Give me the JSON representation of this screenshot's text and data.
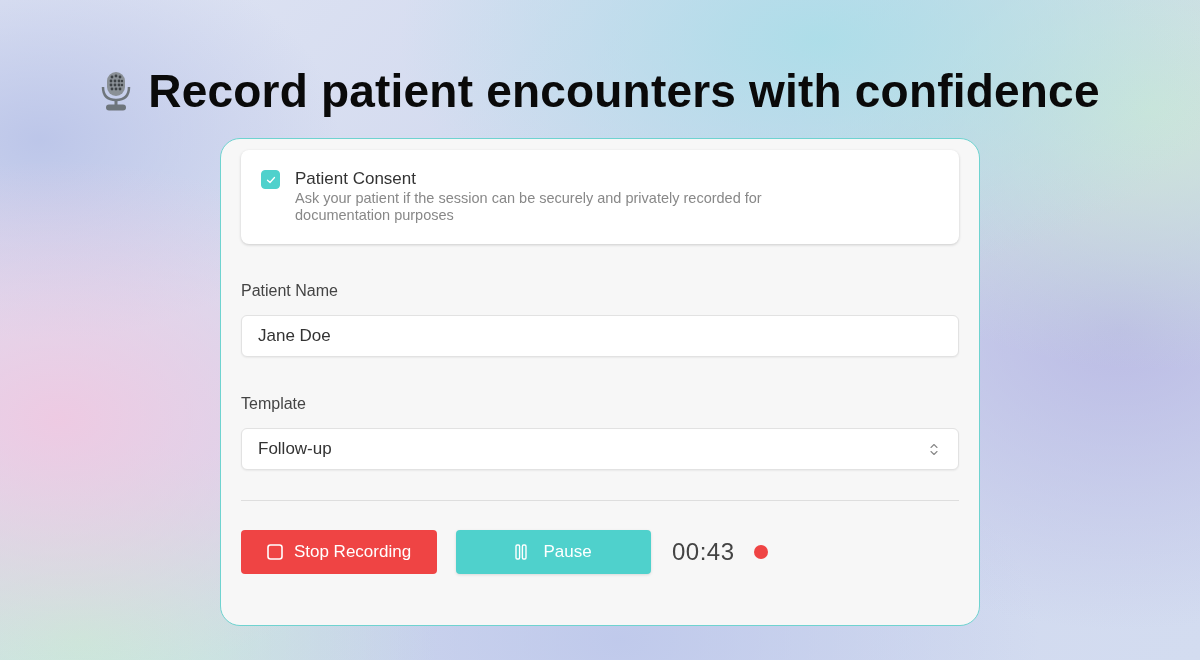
{
  "heading": {
    "title": "Record patient encounters with confidence"
  },
  "consent": {
    "checked": true,
    "title": "Patient Consent",
    "description": "Ask your patient if the session can be securely and privately recorded for documentation purposes"
  },
  "fields": [
    {
      "kind": "text",
      "label": "Patient Name",
      "value": "Jane Doe"
    },
    {
      "kind": "select",
      "label": "Template",
      "value": "Follow-up"
    }
  ],
  "controls": {
    "buttons": [
      {
        "kind": "stop",
        "label": "Stop Recording"
      },
      {
        "kind": "pause",
        "label": "Pause"
      }
    ],
    "timer": "00:43",
    "recording": true
  }
}
